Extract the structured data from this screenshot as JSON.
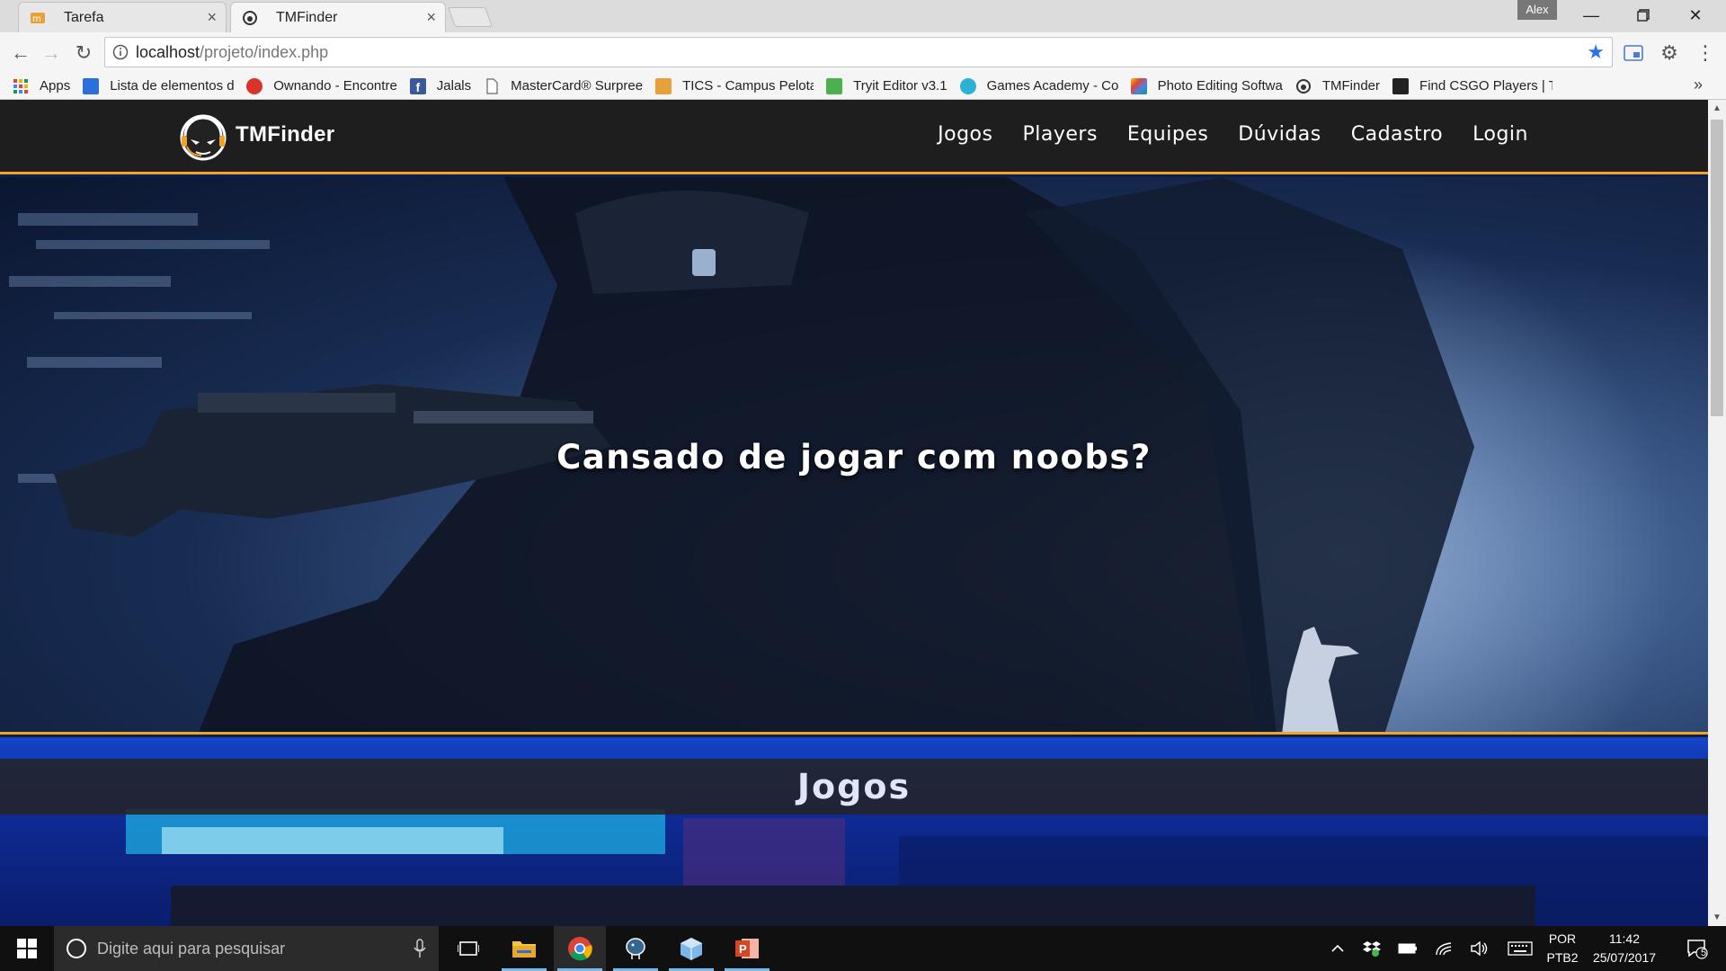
{
  "browser": {
    "tabs": [
      {
        "title": "Tarefa",
        "active": false
      },
      {
        "title": "TMFinder",
        "active": true
      }
    ],
    "profile_name": "Alex",
    "url_host": "localhost",
    "url_path": "/projeto/index.php",
    "bookmarks": [
      {
        "label": "Apps",
        "icon": "apps-grid-icon",
        "color": "#e34234"
      },
      {
        "label": "Lista de elementos do",
        "icon": "bookmark-icon",
        "color": "#2a6fdb"
      },
      {
        "label": "Ownando - Encontre",
        "icon": "bookmark-icon",
        "color": "#d9342b"
      },
      {
        "label": "Jalals",
        "icon": "facebook-icon",
        "color": "#3b5998"
      },
      {
        "label": "MasterCard® Surpree",
        "icon": "page-icon",
        "color": "#ffffff"
      },
      {
        "label": "TICS - Campus Pelota",
        "icon": "bookmark-icon",
        "color": "#e8a13a"
      },
      {
        "label": "Tryit Editor v3.1",
        "icon": "bookmark-icon",
        "color": "#4caf50"
      },
      {
        "label": "Games Academy - Co",
        "icon": "bookmark-icon",
        "color": "#2ab3d6"
      },
      {
        "label": "Photo Editing Softwa",
        "icon": "bookmark-icon",
        "color": "#f0c419"
      },
      {
        "label": "TMFinder",
        "icon": "bookmark-icon",
        "color": "#333333"
      },
      {
        "label": "Find CSGO Players | T",
        "icon": "bookmark-icon",
        "color": "#222222"
      }
    ]
  },
  "site": {
    "logo_text": "TMFinder",
    "menu": [
      "Jogos",
      "Players",
      "Equipes",
      "Dúvidas",
      "Cadastro",
      "Login"
    ],
    "hero_title": "Cansado de jogar com noobs?",
    "section_title": "Jogos",
    "accent_color": "#f0a32a"
  },
  "taskbar": {
    "search_placeholder": "Digite aqui para pesquisar",
    "lang_line1": "POR",
    "lang_line2": "PTB2",
    "time": "11:42",
    "date": "25/07/2017",
    "notification_count": "5"
  }
}
